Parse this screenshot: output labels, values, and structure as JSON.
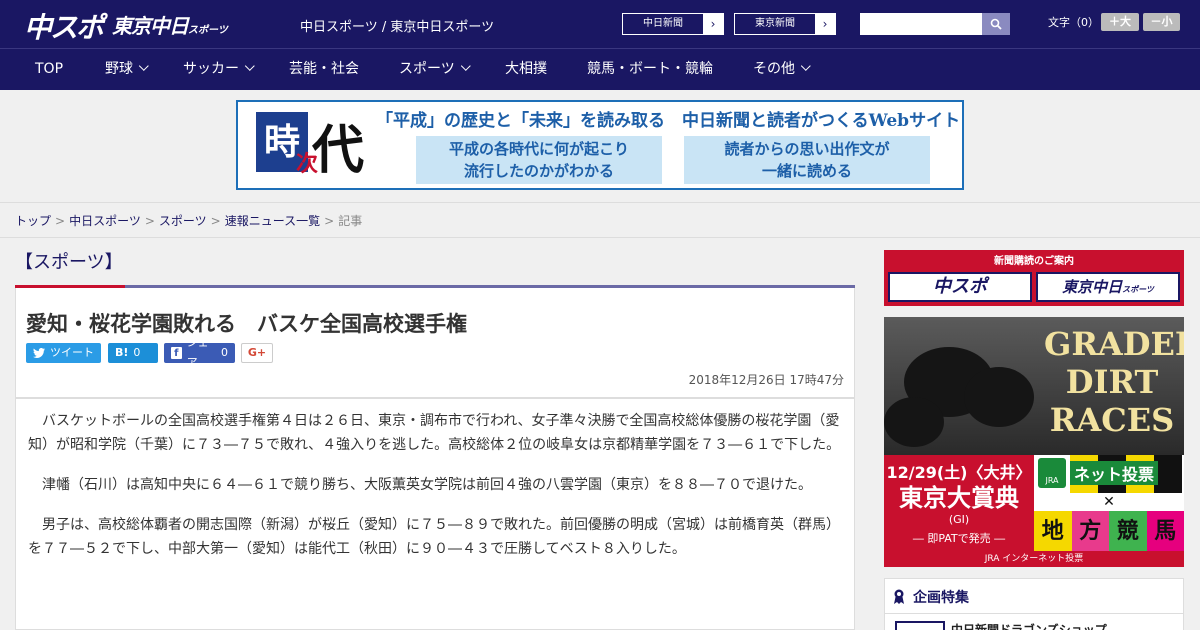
{
  "header": {
    "logo_chuspo": "中スポ",
    "logo_tokyo": "東京中日",
    "logo_tokyo_small": "スポーツ",
    "site_names": "中日スポーツ / 東京中日スポーツ",
    "ext_links": [
      {
        "label": "中日新聞",
        "arrow": "›"
      },
      {
        "label": "東京新聞",
        "arrow": "›"
      }
    ],
    "search_placeholder": "",
    "font_label": "文字（0）",
    "font_bigger": "＋大",
    "font_smaller": "－小"
  },
  "nav": {
    "items": [
      {
        "label": "TOP",
        "has_menu": false
      },
      {
        "label": "野球",
        "has_menu": true
      },
      {
        "label": "サッカー",
        "has_menu": true
      },
      {
        "label": "芸能・社会",
        "has_menu": false
      },
      {
        "label": "スポーツ",
        "has_menu": true
      },
      {
        "label": "大相撲",
        "has_menu": false
      },
      {
        "label": "競馬・ボート・競輪",
        "has_menu": false
      },
      {
        "label": "その他",
        "has_menu": true
      }
    ]
  },
  "banner": {
    "logo_ji": "時",
    "logo_tsugi": "次",
    "logo_dai": "代",
    "headline": "「平成」の歴史と「未来」を読み取る　中日新聞と読者がつくるWebサイト",
    "box_left_line1": "平成の各時代に何が起こり",
    "box_left_line2": "流行したのかがわかる",
    "box_right_line1": "読者からの思い出作文が",
    "box_right_line2": "一緒に読める"
  },
  "breadcrumb": {
    "items": [
      "トップ",
      "中日スポーツ",
      "スポーツ",
      "速報ニュース一覧"
    ],
    "current": "記事",
    "sep": ">"
  },
  "section": {
    "heading": "【スポーツ】"
  },
  "article": {
    "title": "愛知・桜花学園敗れる　バスケ全国高校選手権",
    "share": {
      "tweet": "ツイート",
      "hatena_icon": "B!",
      "hatena_count": "0",
      "facebook_icon": "f",
      "facebook_label": "シェア",
      "facebook_count": "0",
      "gplus": "G+"
    },
    "date": "2018年12月26日 17時47分",
    "paragraphs": [
      "バスケットボールの全国高校選手権第４日は２６日、東京・調布市で行われ、女子準々決勝で全国高校総体優勝の桜花学園（愛知）が昭和学院（千葉）に７３―７５で敗れ、４強入りを逃した。高校総体２位の岐阜女は京都精華学園を７３―６１で下した。",
      "津幡（石川）は高知中央に６４―６１で競り勝ち、大阪薫英女学院は前回４強の八雲学園（東京）を８８―７０で退けた。",
      "男子は、高校総体覇者の開志国際（新潟）が桜丘（愛知）に７５―８９で敗れた。前回優勝の明成（宮城）は前橋育英（群馬）を７７―５２で下し、中部大第一（愛知）は能代工（秋田）に９０―４３で圧勝してベスト８入りした。"
    ]
  },
  "sidebar": {
    "subscribe_head": "新聞購読のご案内",
    "subscribe_left": "中スポ",
    "subscribe_right": "東京中日",
    "subscribe_right_small": "スポーツ",
    "ad": {
      "graded": "GRADED DIRT RACES",
      "date": "12/29(土)〈大井〉",
      "race": "東京大賞典",
      "grade": "(GI)",
      "pat": "― 即PATで発売 ―",
      "jra": "JRA",
      "net": "ネット投票",
      "x": "✕",
      "chiho": [
        "地",
        "方",
        "競",
        "馬"
      ],
      "footer": "JRA インターネット投票"
    },
    "feature_title": "企画特集",
    "feature_item": "中日新聞ドラゴンズショップ"
  },
  "colors": {
    "brand_navy": "#1a1763",
    "accent_red": "#c8102e",
    "twitter": "#2b9ce6",
    "hatena": "#1c8fd8",
    "facebook": "#3b5bb5"
  }
}
